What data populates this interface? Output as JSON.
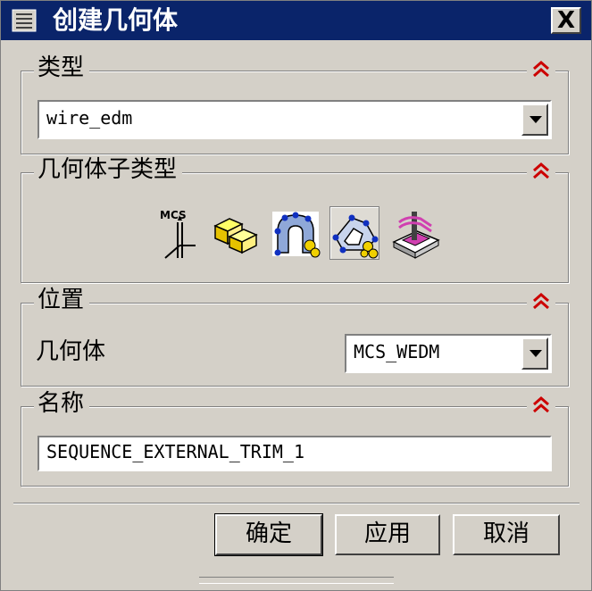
{
  "window": {
    "title": "创建几何体",
    "close_label": "X"
  },
  "groups": {
    "type": {
      "title": "类型",
      "collapse_icon": "double-chevron-up-icon",
      "select": {
        "value": "wire_edm"
      }
    },
    "subtype": {
      "title": "几何体子类型",
      "collapse_icon": "double-chevron-up-icon",
      "icons": [
        {
          "name": "mcs-icon",
          "caption": "MCS",
          "selected": false
        },
        {
          "name": "workpiece-icon",
          "selected": false
        },
        {
          "name": "external-trim-icon",
          "selected": false
        },
        {
          "name": "internal-trim-icon",
          "selected": true
        },
        {
          "name": "sequence-icon",
          "selected": false
        }
      ]
    },
    "location": {
      "title": "位置",
      "collapse_icon": "double-chevron-up-icon",
      "geometry_label": "几何体",
      "geometry_select": {
        "value": "MCS_WEDM"
      }
    },
    "name": {
      "title": "名称",
      "collapse_icon": "double-chevron-up-icon",
      "value": "SEQUENCE_EXTERNAL_TRIM_1"
    }
  },
  "buttons": {
    "ok": "确定",
    "apply": "应用",
    "cancel": "取消"
  },
  "colors": {
    "titlebar": "#0a246a",
    "face": "#d4d0c8",
    "collapse": "#cc0000"
  }
}
